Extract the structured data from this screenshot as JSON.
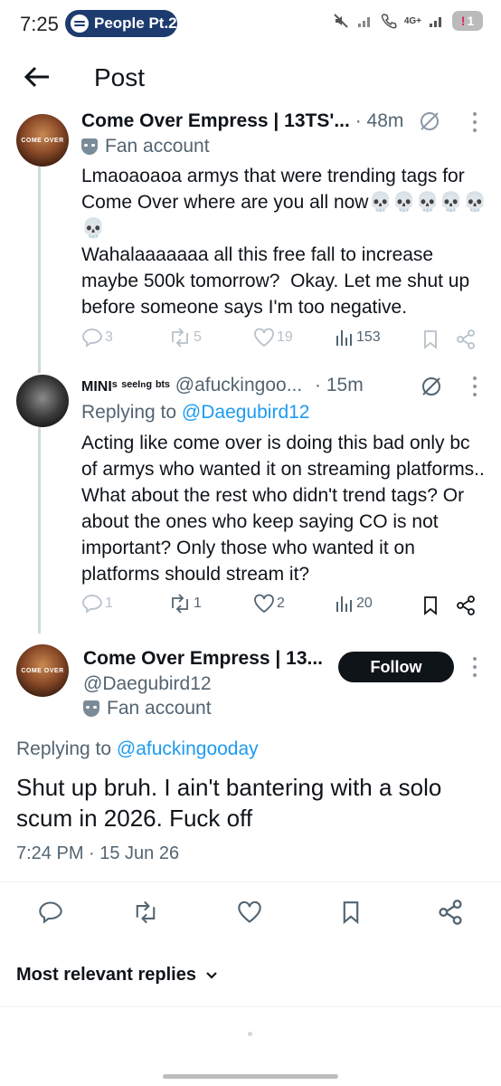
{
  "status_bar": {
    "time": "7:25",
    "media_label": "People Pt.2",
    "network": "4G+",
    "battery": "1"
  },
  "header": {
    "title": "Post"
  },
  "tweets": [
    {
      "name": "Come Over Empress | 13TS'...",
      "time": "· 48m",
      "badge": "Fan account",
      "text": "Lmaoaoaoa armys that were trending tags for Come Over where are you all now💀💀💀💀💀💀\nWahalaaaaaaa all this free fall to increase maybe 500k tomorrow?  Okay. Let me shut up before someone says I'm too negative.",
      "replies": "3",
      "reposts": "5",
      "likes": "19",
      "views": "153",
      "avatar_text": "COME OVER"
    },
    {
      "name": "MINIˢ ˢᵉᵉᴵⁿᵍ ᵇᵗˢ",
      "handle": "@afuckingoo...",
      "time": "· 15m",
      "replying_prefix": "Replying to",
      "replying_to": "@Daegubird12",
      "text": "Acting like come over is doing this bad only bc of armys who wanted it on streaming platforms.. What about the rest who didn't trend tags? Or about the ones who keep saying CO is not important? Only those who wanted it on platforms should stream it?",
      "replies": "1",
      "reposts": "1",
      "likes": "2",
      "views": "20"
    }
  ],
  "main_post": {
    "name": "Come Over Empress | 13...",
    "handle": "@Daegubird12",
    "badge": "Fan account",
    "follow_label": "Follow",
    "replying_prefix": "Replying to",
    "replying_to": "@afuckingooday",
    "text": "Shut up bruh. I ain't bantering with a solo scum in 2026. Fuck off",
    "timestamp": "7:24 PM · 15 Jun 26",
    "avatar_text": "COME OVER"
  },
  "replies_sort": {
    "label": "Most relevant replies"
  },
  "icons": [
    "back-arrow-icon",
    "grok-icon",
    "kebab-icon",
    "reply-icon",
    "repost-icon",
    "like-icon",
    "views-icon",
    "bookmark-icon",
    "share-icon",
    "chevron-down-icon"
  ],
  "colors": {
    "link": "#1d9bf0",
    "muted": "#536471",
    "follow_bg": "#0f1419"
  }
}
